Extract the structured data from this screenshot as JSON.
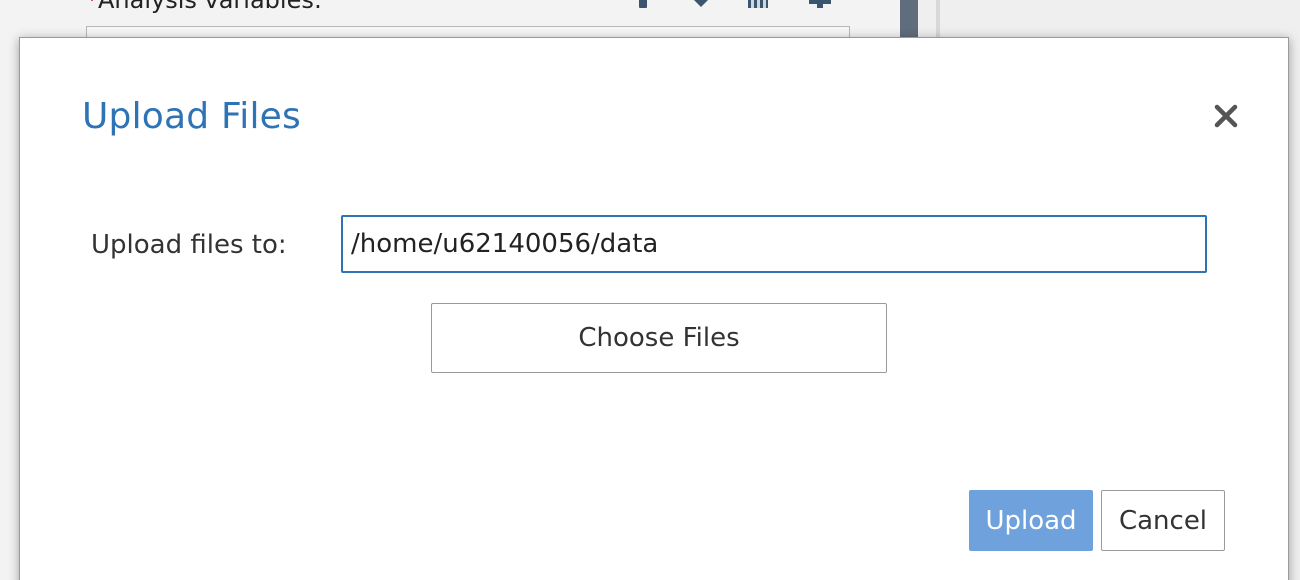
{
  "background": {
    "label_required_marker": "*",
    "label_text": "Analysis variables:",
    "toolbar_icons": [
      "move-up-icon",
      "move-down-icon",
      "delete-icon",
      "add-icon"
    ]
  },
  "dialog": {
    "title": "Upload Files",
    "close_icon": "close-icon",
    "field_label": "Upload files to:",
    "path_value": "/home/u62140056/data",
    "choose_files_label": "Choose Files",
    "upload_label": "Upload",
    "cancel_label": "Cancel"
  },
  "colors": {
    "title": "#2e73b5",
    "input_border": "#2e73b5",
    "upload_button": "#6fa1dc"
  }
}
